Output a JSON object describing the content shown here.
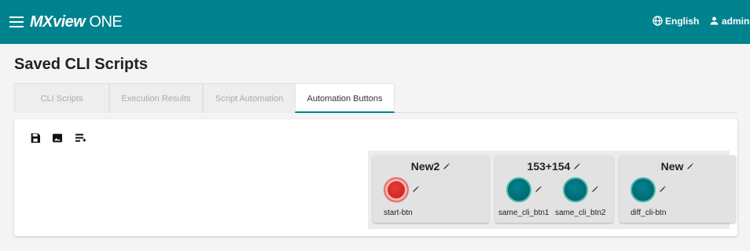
{
  "app": {
    "logo_main": "MXview",
    "logo_suffix": "ONE",
    "language": "English",
    "user": "admin"
  },
  "page": {
    "title": "Saved CLI Scripts"
  },
  "tabs": [
    {
      "label": "CLI Scripts",
      "active": false
    },
    {
      "label": "Execution Results",
      "active": false
    },
    {
      "label": "Script Automation",
      "active": false
    },
    {
      "label": "Automation Buttons",
      "active": true
    }
  ],
  "toolbar": {
    "icons": [
      "save-icon",
      "image-icon",
      "add-list-icon"
    ]
  },
  "groups": [
    {
      "title": "New2",
      "buttons": [
        {
          "label": "start-btn",
          "color": "#d32f2f"
        }
      ]
    },
    {
      "title": "153+154",
      "buttons": [
        {
          "label": "same_cli_btn1",
          "color": "#00838f"
        },
        {
          "label": "same_cli_btn2",
          "color": "#00838f"
        }
      ]
    },
    {
      "title": "New",
      "buttons": [
        {
          "label": "diff_cli-btn",
          "color": "#00838f"
        }
      ]
    }
  ],
  "colors": {
    "brand": "#00838f",
    "danger": "#d32f2f"
  }
}
